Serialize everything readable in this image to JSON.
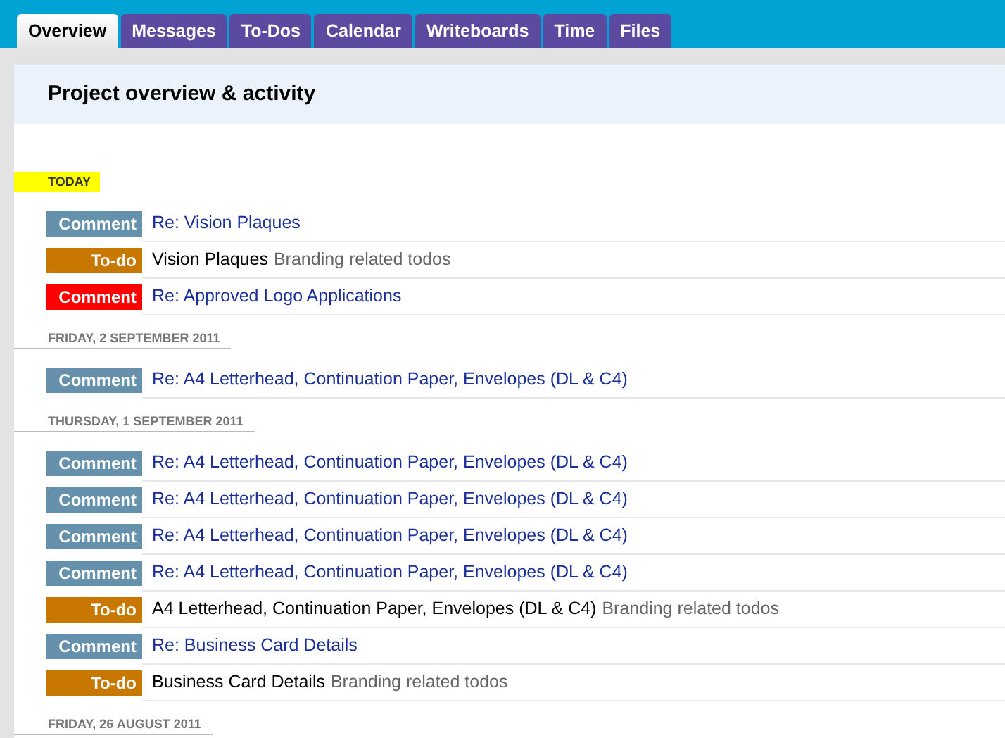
{
  "tabs": [
    {
      "label": "Overview",
      "selected": true
    },
    {
      "label": "Messages",
      "selected": false
    },
    {
      "label": "To-Dos",
      "selected": false
    },
    {
      "label": "Calendar",
      "selected": false
    },
    {
      "label": "Writeboards",
      "selected": false
    },
    {
      "label": "Time",
      "selected": false
    },
    {
      "label": "Files",
      "selected": false
    }
  ],
  "page_title": "Project overview & activity",
  "groups": [
    {
      "date": "TODAY",
      "today": true,
      "items": [
        {
          "kind": "comment",
          "badge": "Comment",
          "color": "#6591ac",
          "title": "Re: Vision Plaques"
        },
        {
          "kind": "todo",
          "badge": "To-do",
          "color": "#c87800",
          "title": "Vision Plaques",
          "list": "Branding related todos"
        },
        {
          "kind": "comment",
          "badge": "Comment",
          "color": "#ff0000",
          "title": "Re: Approved Logo Applications"
        }
      ]
    },
    {
      "date": "FRIDAY, 2 SEPTEMBER 2011",
      "today": false,
      "items": [
        {
          "kind": "comment",
          "badge": "Comment",
          "color": "#6591ac",
          "title": "Re: A4 Letterhead, Continuation Paper, Envelopes (DL & C4)"
        }
      ]
    },
    {
      "date": "THURSDAY, 1 SEPTEMBER 2011",
      "today": false,
      "items": [
        {
          "kind": "comment",
          "badge": "Comment",
          "color": "#6591ac",
          "title": "Re: A4 Letterhead, Continuation Paper, Envelopes (DL & C4)"
        },
        {
          "kind": "comment",
          "badge": "Comment",
          "color": "#6591ac",
          "title": "Re: A4 Letterhead, Continuation Paper, Envelopes (DL & C4)"
        },
        {
          "kind": "comment",
          "badge": "Comment",
          "color": "#6591ac",
          "title": "Re: A4 Letterhead, Continuation Paper, Envelopes (DL & C4)"
        },
        {
          "kind": "comment",
          "badge": "Comment",
          "color": "#6591ac",
          "title": "Re: A4 Letterhead, Continuation Paper, Envelopes (DL & C4)"
        },
        {
          "kind": "todo",
          "badge": "To-do",
          "color": "#c87800",
          "title": "A4 Letterhead, Continuation Paper, Envelopes (DL & C4)",
          "list": "Branding related todos"
        },
        {
          "kind": "comment",
          "badge": "Comment",
          "color": "#6591ac",
          "title": "Re: Business Card Details"
        },
        {
          "kind": "todo",
          "badge": "To-do",
          "color": "#c87800",
          "title": "Business Card Details",
          "list": "Branding related todos"
        }
      ]
    },
    {
      "date": "FRIDAY, 26 AUGUST 2011",
      "today": false
    }
  ]
}
